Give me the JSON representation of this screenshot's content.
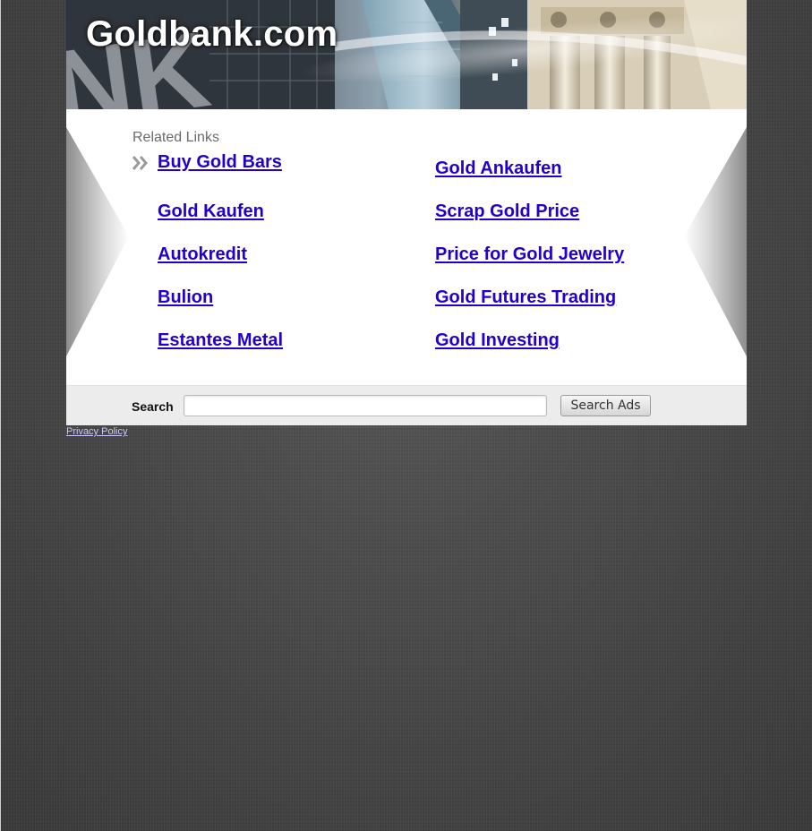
{
  "site": {
    "title": "Goldbank.com"
  },
  "related": {
    "heading": "Related Links",
    "left_links": [
      "Buy Gold Bars",
      "Gold Kaufen",
      "Autokredit",
      "Bulion",
      "Estantes Metal"
    ],
    "right_links": [
      "Gold Ankaufen",
      "Scrap Gold Price",
      "Price for Gold Jewelry",
      "Gold Futures Trading",
      "Gold Investing"
    ]
  },
  "search": {
    "label": "Search",
    "value": "",
    "button_label": "Search Ads"
  },
  "footer": {
    "privacy_label": "Privacy Policy"
  },
  "colors": {
    "link": "#2200cc",
    "background": "#4a4a4a",
    "panel": "#ffffff",
    "search_bar": "#ececec"
  },
  "icons": {
    "bullet": "double-chevron-right-icon"
  }
}
